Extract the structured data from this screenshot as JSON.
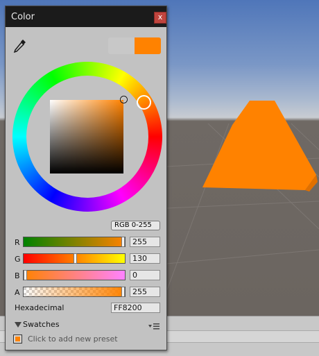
{
  "window": {
    "title": "Color",
    "close_label": "x"
  },
  "colors": {
    "current": "#FF8200",
    "previous": "#C8C8C8",
    "title_bar": "#1B1B1B",
    "close_button": "#C0453E",
    "panel": "#C2C2C2"
  },
  "icons": {
    "eyedropper": "eyedropper-icon",
    "close": "close-icon",
    "swatches_toggle": "triangle-down-icon",
    "swatches_menu": "menu-icon"
  },
  "picker": {
    "hue_degrees": 30.6,
    "saturation": 1.0,
    "value": 1.0
  },
  "mode": {
    "label": "RGB 0-255"
  },
  "channels": [
    {
      "id": "r",
      "label": "R",
      "value": "255",
      "fraction": 1.0,
      "gradient": "linear-gradient(to right,#008200,#ff8200)"
    },
    {
      "id": "g",
      "label": "G",
      "value": "130",
      "fraction": 0.51,
      "gradient": "linear-gradient(to right,#ff0000,#ffff00)"
    },
    {
      "id": "b",
      "label": "B",
      "value": "0",
      "fraction": 0.0,
      "gradient": "linear-gradient(to right,#ff8200,#ff82ff)"
    },
    {
      "id": "a",
      "label": "A",
      "value": "255",
      "fraction": 1.0,
      "gradient": "linear-gradient(to right,rgba(255,130,0,0),#ff8200)"
    }
  ],
  "hex": {
    "label": "Hexadecimal",
    "value": "FF8200"
  },
  "swatches": {
    "label": "Swatches",
    "add_hint": "Click to add new preset"
  }
}
